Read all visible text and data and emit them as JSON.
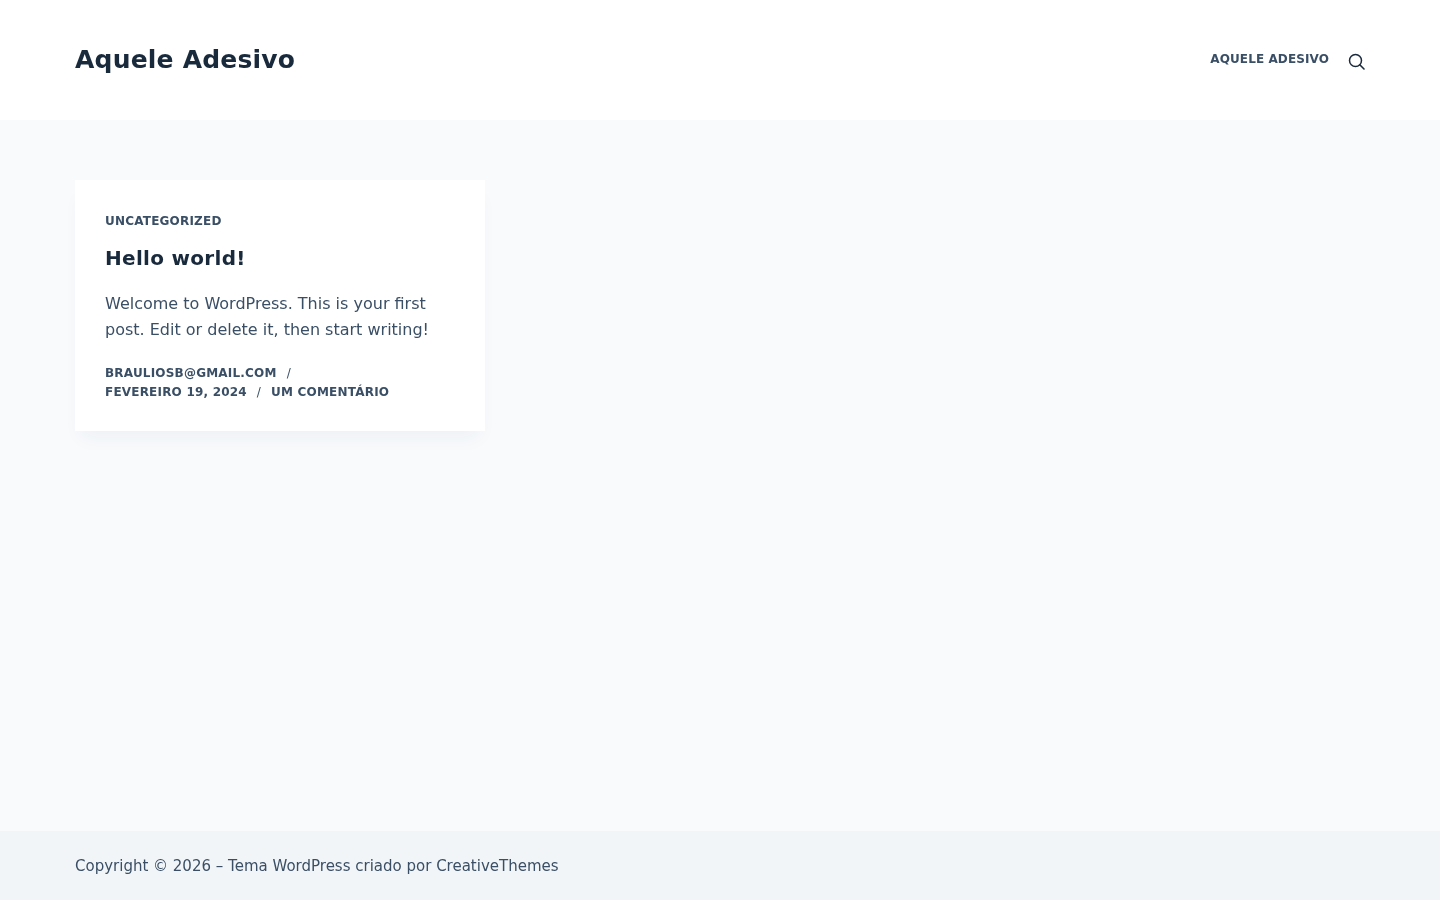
{
  "header": {
    "site_title": "Aquele Adesivo",
    "nav": [
      {
        "label": "AQUELE ADESIVO"
      }
    ]
  },
  "posts": [
    {
      "category": "UNCATEGORIZED",
      "title": "Hello world!",
      "excerpt": "Welcome to WordPress. This is your first post. Edit or delete it, then start writing!",
      "meta": [
        {
          "kind": "author",
          "text": "BRAULIOSB@GMAIL.COM"
        },
        {
          "kind": "separator",
          "text": "/"
        },
        {
          "kind": "date",
          "text": "FEVEREIRO 19, 2024"
        },
        {
          "kind": "separator",
          "text": "/"
        },
        {
          "kind": "comments",
          "text": "UM COMENTÁRIO"
        }
      ]
    }
  ],
  "footer": {
    "copyright": "Copyright © 2026 – Tema WordPress criado por CreativeThemes"
  }
}
